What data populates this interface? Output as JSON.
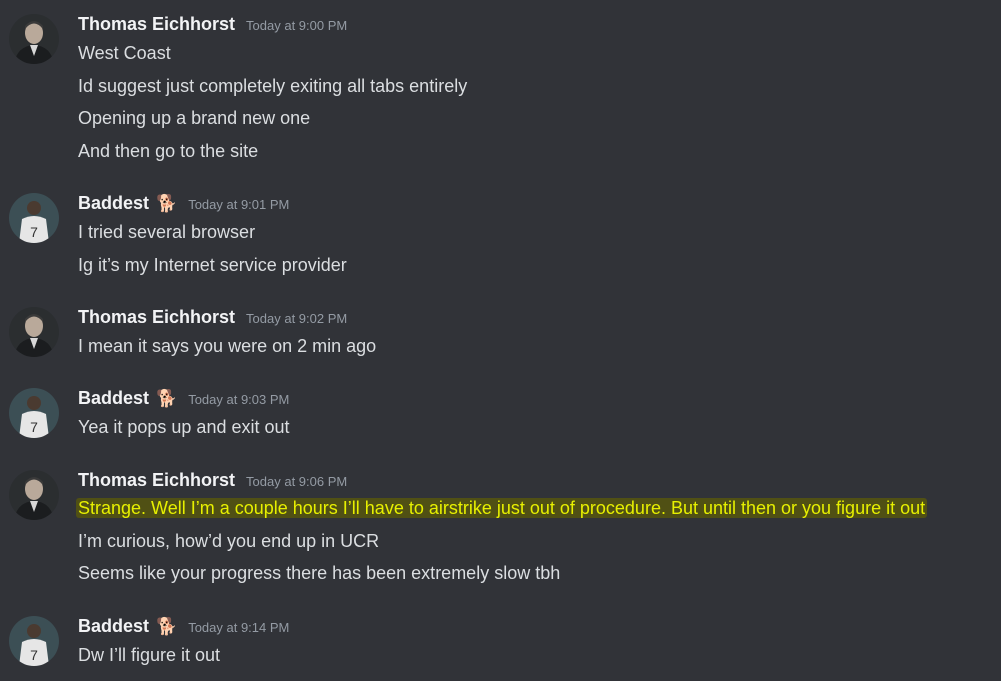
{
  "messages": [
    {
      "author": "Thomas Eichhorst",
      "badge": "",
      "time": "Today at 9:00 PM",
      "lines": [
        "West Coast",
        "Id suggest just completely exiting all tabs entirely",
        "Opening up a brand new one",
        "And then go to the site"
      ]
    },
    {
      "author": "Baddest",
      "badge": "dog-emoji",
      "time": "Today at 9:01 PM",
      "lines": [
        "I tried several browser",
        "Ig it’s my Internet service provider"
      ]
    },
    {
      "author": "Thomas Eichhorst",
      "badge": "",
      "time": "Today at 9:02 PM",
      "lines": [
        "I mean it says you were on 2 min ago"
      ]
    },
    {
      "author": "Baddest",
      "badge": "dog-emoji",
      "time": "Today at 9:03 PM",
      "lines": [
        "Yea it pops up and exit out"
      ]
    },
    {
      "author": "Thomas Eichhorst",
      "badge": "",
      "time": "Today at 9:06 PM",
      "lines": [
        "Strange.  Well I’m a couple hours I’ll have to airstrike just out of procedure.  But until then or you figure it out",
        "I’m curious, how’d you end up in UCR",
        "Seems like your progress there has been extremely slow tbh"
      ]
    },
    {
      "author": "Baddest",
      "badge": "dog-emoji",
      "time": "Today at 9:14 PM",
      "lines": [
        "Dw I’ll figure it out"
      ]
    }
  ],
  "colors": {
    "background": "#313338",
    "username": "#f2f3f5",
    "text": "#dbdee1",
    "timestamp": "#949ba4",
    "highlight_text": "#e7f000"
  }
}
